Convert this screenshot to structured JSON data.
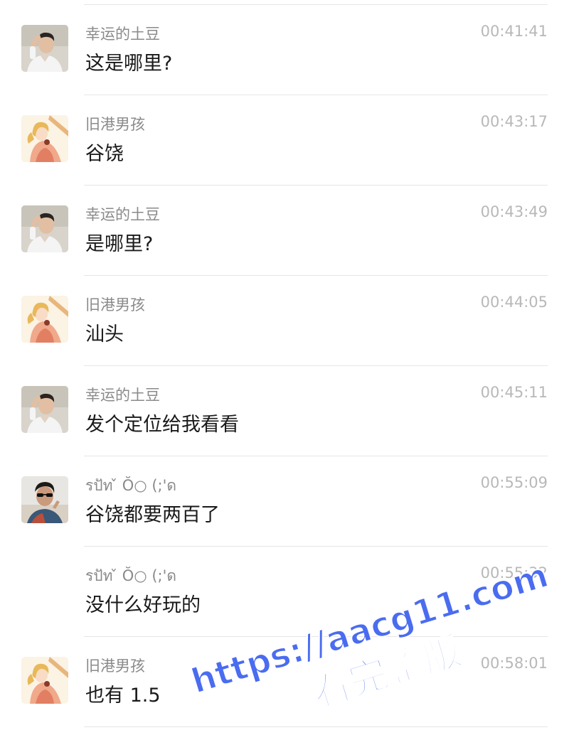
{
  "colors": {
    "sender": "#8a8a8a",
    "time": "#b8b8b8",
    "text": "#1a1a1a",
    "divider": "#e6e6e6",
    "watermark": "#4a6cf0"
  },
  "messages": [
    {
      "sender": "幸运的土豆",
      "time": "00:41:41",
      "text": "这是哪里?",
      "avatar": "man-white-shirt-avatar"
    },
    {
      "sender": "旧港男孩",
      "time": "00:43:17",
      "text": "谷饶",
      "avatar": "anime-character-avatar"
    },
    {
      "sender": "幸运的土豆",
      "time": "00:43:49",
      "text": "是哪里?",
      "avatar": "man-white-shirt-avatar"
    },
    {
      "sender": "旧港男孩",
      "time": "00:44:05",
      "text": "汕头",
      "avatar": "anime-character-avatar"
    },
    {
      "sender": "幸运的土豆",
      "time": "00:45:11",
      "text": "发个定位给我看看",
      "avatar": "man-white-shirt-avatar"
    },
    {
      "sender": "รปัท ̌ Ŏ○ (;'ด",
      "time": "00:55:09",
      "text": "谷饶都要两百了",
      "avatar": "sunglasses-person-avatar"
    },
    {
      "sender": "รปัท ̌ Ŏ○ (;'ด",
      "time": "00:55:32",
      "text": "没什么好玩的",
      "avatar": ""
    },
    {
      "sender": "旧港男孩",
      "time": "00:58:01",
      "text": "也有 1.5",
      "avatar": "anime-character-avatar"
    }
  ],
  "watermark": {
    "line1": "https://aacg11.com",
    "line2": "看完整版"
  }
}
